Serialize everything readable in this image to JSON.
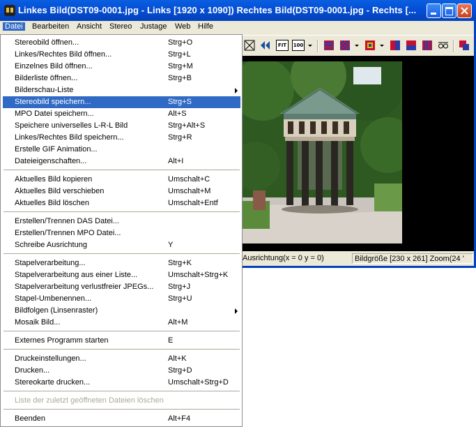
{
  "window": {
    "title": "Linkes Bild(DST09-0001.jpg - Links [1920 x 1090]) Rechtes Bild(DST09-0001.jpg - Rechts [..."
  },
  "menubar": {
    "items": [
      {
        "label": "Datei"
      },
      {
        "label": "Bearbeiten"
      },
      {
        "label": "Ansicht"
      },
      {
        "label": "Stereo"
      },
      {
        "label": "Justage"
      },
      {
        "label": "Web"
      },
      {
        "label": "Hilfe"
      }
    ]
  },
  "toolbar": {
    "fit_label": "FIT",
    "zoom100_label": "100"
  },
  "status": {
    "alignment": "Ausrichtung(x = 0 y = 0)",
    "imagesize": "Bildgröße [230 x 261]  Zoom(24 '"
  },
  "menu": {
    "items": [
      {
        "label": "Stereobild öffnen...",
        "shortcut": "Strg+O"
      },
      {
        "label": "Linkes/Rechtes Bild öffnen...",
        "shortcut": "Strg+L"
      },
      {
        "label": "Einzelnes Bild öffnen...",
        "shortcut": "Strg+M"
      },
      {
        "label": "Bilderliste öffnen...",
        "shortcut": "Strg+B"
      },
      {
        "label": "Bilderschau-Liste",
        "shortcut": ""
      },
      {
        "label": "Stereobild speichern...",
        "shortcut": "Strg+S"
      },
      {
        "label": "MPO Datei speichern...",
        "shortcut": "Alt+S"
      },
      {
        "label": "Speichere universelles L-R-L Bild",
        "shortcut": "Strg+Alt+S"
      },
      {
        "label": "Linkes/Rechtes Bild speichern...",
        "shortcut": "Strg+R"
      },
      {
        "label": "Erstelle GIF Animation...",
        "shortcut": ""
      },
      {
        "label": "Dateieigenschaften...",
        "shortcut": "Alt+I"
      },
      {
        "label": "Aktuelles Bild kopieren",
        "shortcut": "Umschalt+C"
      },
      {
        "label": "Aktuelles Bild verschieben",
        "shortcut": "Umschalt+M"
      },
      {
        "label": "Aktuelles Bild löschen",
        "shortcut": "Umschalt+Entf"
      },
      {
        "label": "Erstellen/Trennen DAS Datei...",
        "shortcut": ""
      },
      {
        "label": "Erstellen/Trennen MPO Datei...",
        "shortcut": ""
      },
      {
        "label": "Schreibe Ausrichtung",
        "shortcut": "Y"
      },
      {
        "label": "Stapelverarbeitung...",
        "shortcut": "Strg+K"
      },
      {
        "label": "Stapelverarbeitung aus einer Liste...",
        "shortcut": "Umschalt+Strg+K"
      },
      {
        "label": "Stapelverarbeitung verlustfreier JPEGs...",
        "shortcut": "Strg+J"
      },
      {
        "label": "Stapel-Umbenennen...",
        "shortcut": "Strg+U"
      },
      {
        "label": "Bildfolgen (Linsenraster)",
        "shortcut": ""
      },
      {
        "label": "Mosaik Bild...",
        "shortcut": "Alt+M"
      },
      {
        "label": "Externes Programm starten",
        "shortcut": "E"
      },
      {
        "label": "Druckeinstellungen...",
        "shortcut": "Alt+K"
      },
      {
        "label": "Drucken...",
        "shortcut": "Strg+D"
      },
      {
        "label": "Stereokarte drucken...",
        "shortcut": "Umschalt+Strg+D"
      },
      {
        "label": "Liste der zuletzt geöffneten Dateien löschen",
        "shortcut": ""
      },
      {
        "label": "Beenden",
        "shortcut": "Alt+F4"
      }
    ]
  }
}
